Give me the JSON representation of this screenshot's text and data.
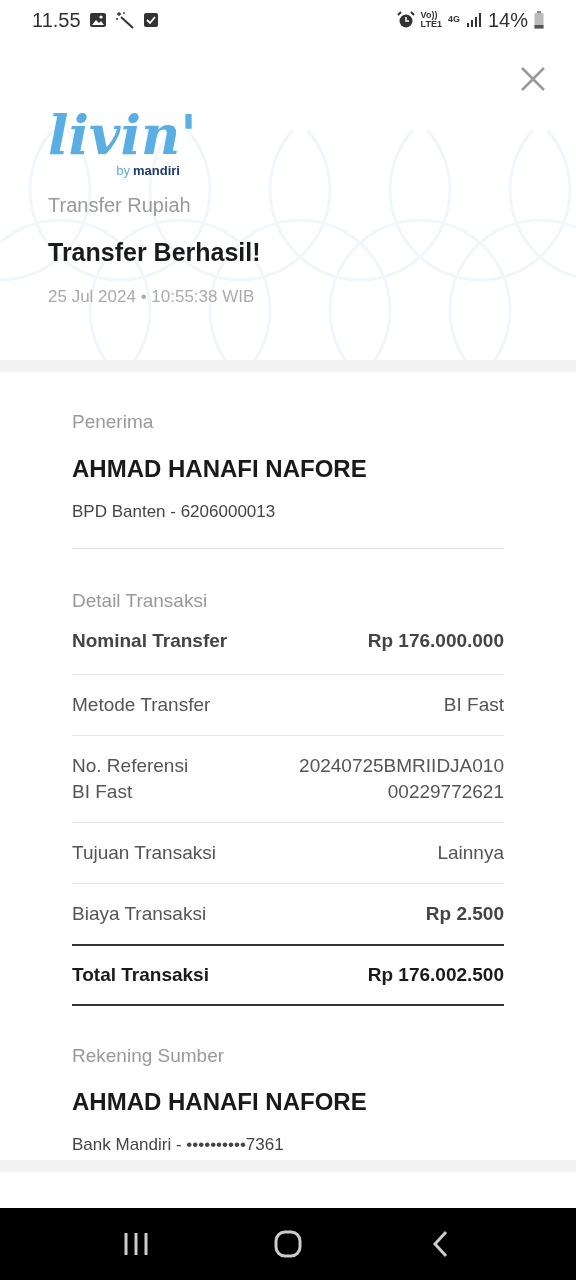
{
  "status_bar": {
    "time": "11.55",
    "volte": "Vo))",
    "lte": "LTE1",
    "network": "4G",
    "battery": "14%"
  },
  "header": {
    "logo": "livin'",
    "logo_sub_by": "by",
    "logo_sub_brand": "mandiri",
    "category": "Transfer Rupiah",
    "title": "Transfer Berhasil!",
    "timestamp": "25 Jul 2024 • 10:55:38 WIB"
  },
  "recipient": {
    "label": "Penerima",
    "name": "AHMAD HANAFI NAFORE",
    "account": "BPD Banten - 6206000013"
  },
  "details": {
    "label": "Detail Transaksi",
    "rows": [
      {
        "kind": "item",
        "label": [
          "Nominal Transfer"
        ],
        "value": [
          "Rp 176.000.000"
        ],
        "label_bold": true,
        "value_bold": true
      },
      {
        "kind": "item",
        "label": [
          "Metode Transfer"
        ],
        "value": [
          "BI Fast"
        ],
        "label_bold": false,
        "value_bold": false
      },
      {
        "kind": "item",
        "label": [
          "No. Referensi",
          "BI Fast"
        ],
        "value": [
          "20240725BMRIIDJA010",
          "00229772621"
        ],
        "label_bold": false,
        "value_bold": false
      },
      {
        "kind": "item",
        "label": [
          "Tujuan Transaksi"
        ],
        "value": [
          "Lainnya"
        ],
        "label_bold": false,
        "value_bold": false
      },
      {
        "kind": "item",
        "label": [
          "Biaya Transaksi"
        ],
        "value": [
          "Rp 2.500"
        ],
        "label_bold": false,
        "value_bold": true
      },
      {
        "kind": "total",
        "label": [
          "Total Transaksi"
        ],
        "value": [
          "Rp 176.002.500"
        ],
        "label_bold": true,
        "value_bold": true
      }
    ]
  },
  "source": {
    "label": "Rekening Sumber",
    "name": "AHMAD HANAFI NAFORE",
    "account": "Bank Mandiri - ••••••••••7361"
  }
}
